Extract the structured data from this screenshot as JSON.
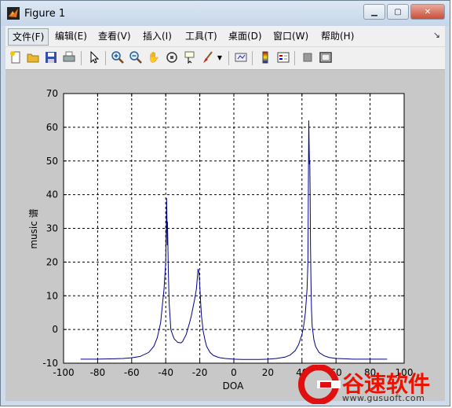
{
  "window": {
    "title": "Figure 1",
    "controls": {
      "minimize": "▁",
      "maximize": "▢",
      "close": "✕"
    }
  },
  "menubar": {
    "items": [
      "文件(F)",
      "编辑(E)",
      "查看(V)",
      "插入(I)",
      "工具(T)",
      "桌面(D)",
      "窗口(W)",
      "帮助(H)"
    ],
    "active_index": 0,
    "overflow_icon": "dock-arrow-icon"
  },
  "toolbar": {
    "buttons": [
      {
        "icon": "new-figure-icon"
      },
      {
        "icon": "open-file-icon"
      },
      {
        "icon": "save-icon"
      },
      {
        "icon": "print-icon"
      },
      {
        "icon": "edit-plot-arrow-icon"
      },
      {
        "icon": "zoom-in-icon"
      },
      {
        "icon": "zoom-out-icon"
      },
      {
        "icon": "pan-hand-icon"
      },
      {
        "icon": "rotate-3d-icon"
      },
      {
        "icon": "data-cursor-icon"
      },
      {
        "icon": "brush-icon"
      },
      {
        "icon": "brush-dropdown-icon"
      },
      {
        "icon": "link-plot-icon"
      },
      {
        "icon": "colorbar-icon"
      },
      {
        "icon": "legend-icon"
      },
      {
        "icon": "hide-plot-tools-icon"
      },
      {
        "icon": "show-plot-tools-icon"
      }
    ]
  },
  "chart_data": {
    "type": "line",
    "title": "",
    "xlabel": "DOA",
    "ylabel": "music 谱",
    "xlim": [
      -100,
      100
    ],
    "ylim": [
      -10,
      70
    ],
    "xticks": [
      -100,
      -80,
      -60,
      -40,
      -20,
      0,
      20,
      40,
      60,
      80,
      100
    ],
    "yticks": [
      -10,
      0,
      10,
      20,
      30,
      40,
      50,
      60,
      70
    ],
    "grid": true,
    "grid_style": "dashed",
    "line_color": "#00008b",
    "series": [
      {
        "x": [
          -90,
          -80,
          -70,
          -65,
          -60,
          -55,
          -50,
          -47,
          -45,
          -43,
          -42,
          -41,
          -40,
          -39.7,
          -39.5,
          -39.3,
          -39.1,
          -39,
          -38.8,
          -38.5,
          -38,
          -37,
          -36,
          -35,
          -33,
          -31,
          -30,
          -28,
          -26,
          -25,
          -24,
          -23,
          -22,
          -21,
          -20.5,
          -20,
          -19.5,
          -19,
          -18,
          -17,
          -16,
          -14,
          -12,
          -10,
          -8,
          -5,
          0,
          5,
          10,
          15,
          20,
          25,
          30,
          33,
          36,
          38,
          40,
          41,
          42,
          43,
          43.5,
          43.8,
          44,
          44.2,
          44.4,
          44.6,
          44.8,
          45,
          45.3,
          45.6,
          46,
          47,
          48,
          50,
          53,
          56,
          60,
          65,
          70,
          80,
          90
        ],
        "y": [
          -8.8,
          -8.8,
          -8.7,
          -8.6,
          -8.4,
          -8,
          -6.8,
          -5,
          -2.5,
          2,
          7,
          12,
          20,
          30,
          39,
          33,
          25,
          32,
          27,
          18,
          8,
          0,
          -1.5,
          -2.8,
          -3.8,
          -4,
          -3.5,
          -1.5,
          2,
          4,
          6.5,
          9,
          12,
          18,
          17,
          13,
          8,
          4,
          -0.5,
          -3,
          -5,
          -6.8,
          -7.7,
          -8.1,
          -8.4,
          -8.6,
          -8.8,
          -8.9,
          -8.9,
          -8.9,
          -8.8,
          -8.6,
          -8.2,
          -7.6,
          -6.3,
          -4.5,
          -1.5,
          1,
          5,
          12,
          20,
          45,
          62,
          55,
          49,
          50,
          40,
          25,
          14,
          6,
          1,
          -3,
          -5,
          -6.8,
          -7.8,
          -8.3,
          -8.6,
          -8.7,
          -8.8,
          -8.8,
          -8.8
        ]
      }
    ]
  },
  "watermark": {
    "text": "谷速软件",
    "url": "www.gusuoft.com"
  }
}
